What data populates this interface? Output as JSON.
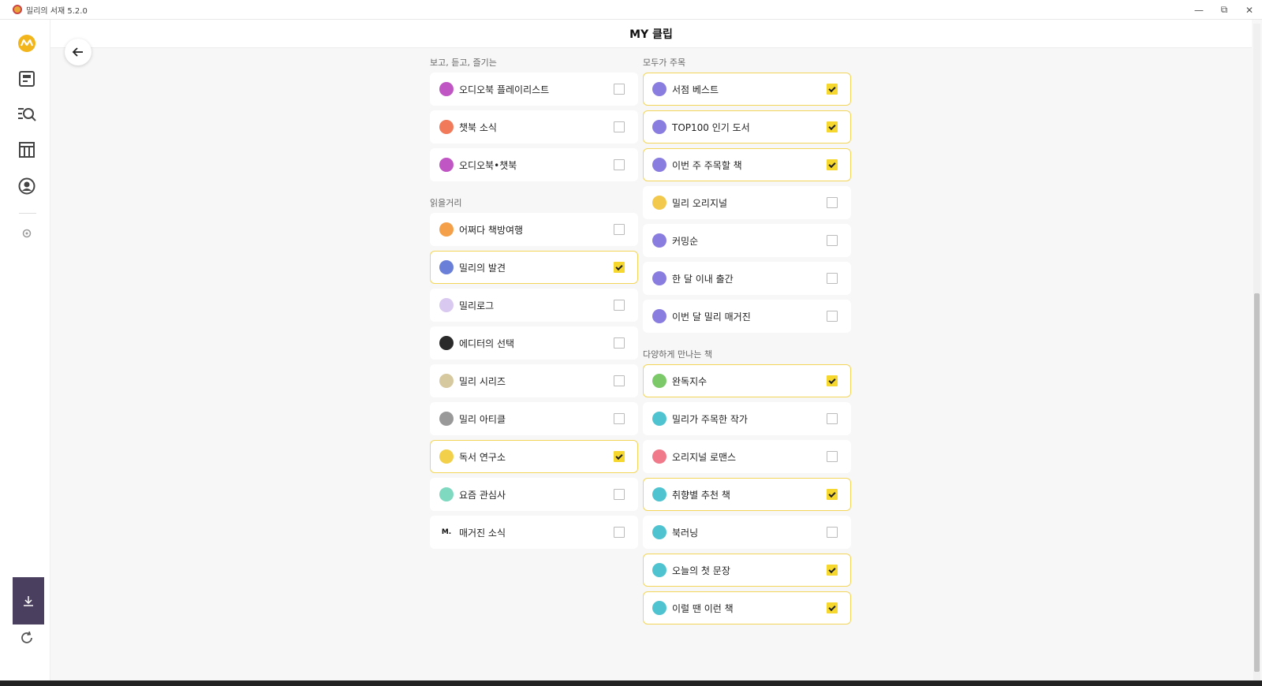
{
  "window": {
    "title": "밀리의 서재 5.2.0"
  },
  "header": {
    "title": "MY 클립"
  },
  "columns": [
    {
      "sections": [
        {
          "title": "보고, 듣고, 즐기는",
          "items": [
            {
              "label": "오디오북 플레이리스트",
              "checked": false,
              "icon_color": "#c056c4",
              "icon": "headphones-icon"
            },
            {
              "label": "챗북 소식",
              "checked": false,
              "icon_color": "#f07a5a",
              "icon": "chat-icon"
            },
            {
              "label": "오디오북•챗북",
              "checked": false,
              "icon_color": "#c056c4",
              "icon": "headphones-icon"
            }
          ]
        },
        {
          "title": "읽을거리",
          "items": [
            {
              "label": "어쩌다 책방여행",
              "checked": false,
              "icon_color": "#f4a04a",
              "icon": "bookstore-icon"
            },
            {
              "label": "밀리의 발견",
              "checked": true,
              "icon_color": "#6a7fd8",
              "icon": "discovery-icon"
            },
            {
              "label": "밀리로그",
              "checked": false,
              "icon_color": "#d9c8f0",
              "icon": "millilog-icon"
            },
            {
              "label": "에디터의 선택",
              "checked": false,
              "icon_color": "#2a2a2a",
              "icon": "editor-icon"
            },
            {
              "label": "밀리 시리즈",
              "checked": false,
              "icon_color": "#d6c9a0",
              "icon": "series-icon"
            },
            {
              "label": "밀리 아티클",
              "checked": false,
              "icon_color": "#999999",
              "icon": "article-icon"
            },
            {
              "label": "독서 연구소",
              "checked": true,
              "icon_color": "#f2d04a",
              "icon": "researcher-icon"
            },
            {
              "label": "요즘 관심사",
              "checked": false,
              "icon_color": "#7fd8c0",
              "icon": "interest-icon"
            },
            {
              "label": "매거진 소식",
              "checked": false,
              "icon_color": "#ffffff",
              "icon": "magazine-icon",
              "glyph": "M."
            }
          ]
        }
      ]
    },
    {
      "sections": [
        {
          "title": "모두가 주목",
          "items": [
            {
              "label": "서점 베스트",
              "checked": true,
              "icon_color": "#8a7de0",
              "icon": "book-icon"
            },
            {
              "label": "TOP100 인기 도서",
              "checked": true,
              "icon_color": "#8a7de0",
              "icon": "book-icon"
            },
            {
              "label": "이번 주 주목할 책",
              "checked": true,
              "icon_color": "#8a7de0",
              "icon": "book-icon"
            },
            {
              "label": "밀리 오리지널",
              "checked": false,
              "icon_color": "#f2c94c",
              "icon": "original-icon"
            },
            {
              "label": "커밍순",
              "checked": false,
              "icon_color": "#8a7de0",
              "icon": "book-icon"
            },
            {
              "label": "한 달 이내 출간",
              "checked": false,
              "icon_color": "#8a7de0",
              "icon": "book-icon"
            },
            {
              "label": "이번 달 밀리 매거진",
              "checked": false,
              "icon_color": "#8a7de0",
              "icon": "book-icon"
            }
          ]
        },
        {
          "title": "다양하게 만나는 책",
          "items": [
            {
              "label": "완독지수",
              "checked": true,
              "icon_color": "#7cc96a",
              "icon": "grid-icon"
            },
            {
              "label": "밀리가 주목한 작가",
              "checked": false,
              "icon_color": "#4fc3d0",
              "icon": "book-icon"
            },
            {
              "label": "오리지널 로맨스",
              "checked": false,
              "icon_color": "#f07a8a",
              "icon": "book-icon"
            },
            {
              "label": "취향별 추천 책",
              "checked": true,
              "icon_color": "#4fc3d0",
              "icon": "book-icon"
            },
            {
              "label": "북러닝",
              "checked": false,
              "icon_color": "#4fc3d0",
              "icon": "book-icon"
            },
            {
              "label": "오늘의 첫 문장",
              "checked": true,
              "icon_color": "#4fc3d0",
              "icon": "book-icon"
            },
            {
              "label": "이럴 땐 이런 책",
              "checked": true,
              "icon_color": "#4fc3d0",
              "icon": "book-icon"
            }
          ]
        }
      ]
    }
  ],
  "colors": {
    "accent": "#f5d72e",
    "brand": "#f2b51b"
  }
}
